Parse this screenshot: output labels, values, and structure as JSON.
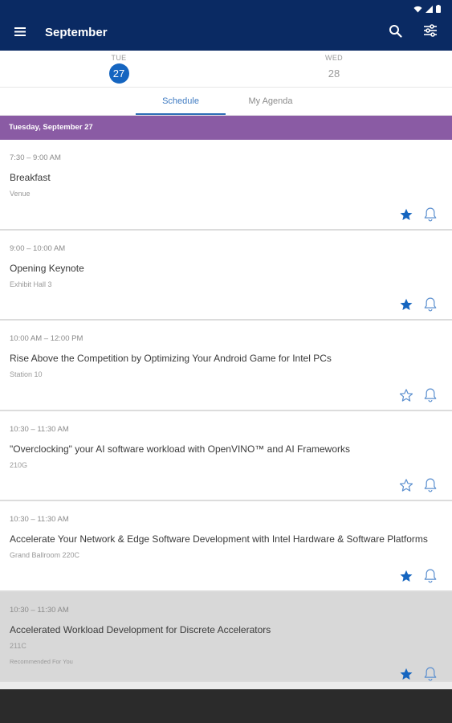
{
  "app": {
    "title": "September"
  },
  "dates": [
    {
      "dow": "TUE",
      "num": "27",
      "selected": true
    },
    {
      "dow": "WED",
      "num": "28",
      "selected": false
    }
  ],
  "tabs": [
    {
      "label": "Schedule",
      "active": true
    },
    {
      "label": "My Agenda",
      "active": false
    }
  ],
  "day_header": "Tuesday, September 27",
  "sessions": [
    {
      "time": "7:30 – 9:00 AM",
      "title": "Breakfast",
      "location": "Venue",
      "tag": "",
      "starred": true
    },
    {
      "time": "9:00 – 10:00 AM",
      "title": "Opening Keynote",
      "location": "Exhibit Hall 3",
      "tag": "",
      "starred": true
    },
    {
      "time": "10:00 AM – 12:00 PM",
      "title": "Rise Above the Competition by Optimizing Your Android Game for Intel PCs",
      "location": "Station 10",
      "tag": "",
      "starred": false
    },
    {
      "time": "10:30 – 11:30 AM",
      "title": "\"Overclocking\" your AI software workload with OpenVINO™ and AI Frameworks",
      "location": "210G",
      "tag": "",
      "starred": false
    },
    {
      "time": "10:30 – 11:30 AM",
      "title": "Accelerate Your Network & Edge Software Development with Intel Hardware & Software Platforms",
      "location": "Grand Ballroom 220C",
      "tag": "",
      "starred": true
    },
    {
      "time": "10:30 – 11:30 AM",
      "title": "Accelerated Workload Development for Discrete Accelerators",
      "location": "211C",
      "tag": "Recommended For You",
      "starred": true
    }
  ],
  "colors": {
    "appbar": "#0a2a63",
    "accent": "#1565c0",
    "day_header": "#8a5ba4",
    "star_filled": "#1565c0",
    "icon_outline": "#5b8fcf"
  },
  "icons": {
    "menu": "menu-icon",
    "search": "search-icon",
    "filter": "filter-sliders-icon",
    "star": "star-icon",
    "bell": "bell-icon",
    "wifi": "wifi-icon",
    "signal": "signal-icon",
    "battery": "battery-icon"
  }
}
